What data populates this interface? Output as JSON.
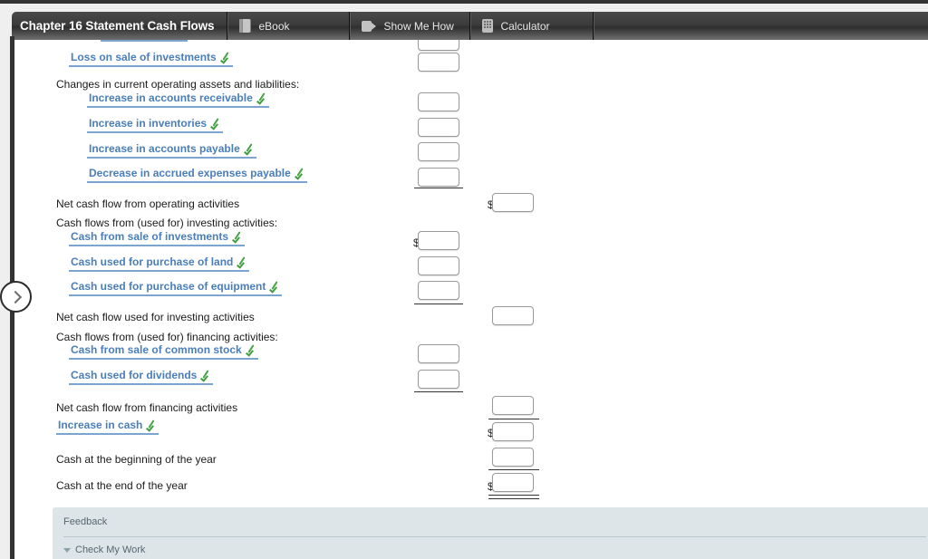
{
  "toolbar": {
    "title": "Chapter 16 Statement Cash Flows",
    "tabs": [
      {
        "label": "eBook",
        "icon": "book-icon"
      },
      {
        "label": "Show Me How",
        "icon": "video-camera-icon"
      },
      {
        "label": "Calculator",
        "icon": "calculator-icon"
      }
    ]
  },
  "expander": {
    "icon": "chevron-right-icon"
  },
  "statement": {
    "rows": [
      {
        "type": "pick",
        "label": "Loss on sale of investments",
        "indent": 63,
        "checked": true
      },
      {
        "type": "plain",
        "label": "Changes in current operating assets and liabilities:",
        "indent": 49
      },
      {
        "type": "pick",
        "label": "Increase in accounts receivable",
        "indent": 83,
        "checked": true
      },
      {
        "type": "pick",
        "label": "Increase in inventories",
        "indent": 83,
        "checked": true
      },
      {
        "type": "pick",
        "label": "Increase in accounts payable",
        "indent": 83,
        "checked": true
      },
      {
        "type": "pick",
        "label": "Decrease in accrued expenses payable",
        "indent": 83,
        "checked": true
      },
      {
        "type": "plain",
        "label": "Net cash flow from operating activities",
        "indent": 49
      },
      {
        "type": "plain",
        "label": "Cash flows from (used for) investing activities:",
        "indent": 49
      },
      {
        "type": "pick",
        "label": "Cash from sale of investments",
        "indent": 63,
        "checked": true
      },
      {
        "type": "pick",
        "label": "Cash used for purchase of land",
        "indent": 63,
        "checked": true
      },
      {
        "type": "pick",
        "label": "Cash used for purchase of equipment",
        "indent": 63,
        "checked": true
      },
      {
        "type": "plain",
        "label": "Net cash flow used for investing activities",
        "indent": 49
      },
      {
        "type": "plain",
        "label": "Cash flows from (used for) financing activities:",
        "indent": 49
      },
      {
        "type": "pick",
        "label": "Cash from sale of common stock",
        "indent": 63,
        "checked": true
      },
      {
        "type": "pick",
        "label": "Cash used for dividends",
        "indent": 63,
        "checked": true
      },
      {
        "type": "plain",
        "label": "Net cash flow from financing activities",
        "indent": 49
      },
      {
        "type": "pick",
        "label": "Increase in cash",
        "indent": 49,
        "checked": true
      },
      {
        "type": "plain",
        "label": "Cash at the beginning of the year",
        "indent": 49
      },
      {
        "type": "plain",
        "label": "Cash at the end of the year",
        "indent": 49
      }
    ],
    "inputs": [
      {
        "name": "input-loss-on-sale-of-investments",
        "value": "",
        "dollar": ""
      },
      {
        "name": "input-increase-accounts-receivable",
        "value": "",
        "dollar": ""
      },
      {
        "name": "input-increase-inventories",
        "value": "",
        "dollar": ""
      },
      {
        "name": "input-increase-accounts-payable",
        "value": "",
        "dollar": ""
      },
      {
        "name": "input-decrease-accrued-expenses-payable",
        "value": "",
        "dollar": ""
      },
      {
        "name": "input-net-cash-flow-operating",
        "value": "",
        "dollar": "$"
      },
      {
        "name": "input-cash-from-sale-of-investments",
        "value": "",
        "dollar": "$"
      },
      {
        "name": "input-cash-purchase-of-land",
        "value": "",
        "dollar": ""
      },
      {
        "name": "input-cash-purchase-of-equipment",
        "value": "",
        "dollar": ""
      },
      {
        "name": "input-net-cash-flow-investing",
        "value": "",
        "dollar": ""
      },
      {
        "name": "input-cash-from-sale-common-stock",
        "value": "",
        "dollar": ""
      },
      {
        "name": "input-cash-used-for-dividends",
        "value": "",
        "dollar": ""
      },
      {
        "name": "input-net-cash-flow-financing",
        "value": "",
        "dollar": ""
      },
      {
        "name": "input-increase-in-cash",
        "value": "",
        "dollar": "$"
      },
      {
        "name": "input-cash-beginning-of-year",
        "value": "",
        "dollar": ""
      },
      {
        "name": "input-cash-end-of-year",
        "value": "",
        "dollar": "$"
      }
    ]
  },
  "feedback": {
    "title": "Feedback",
    "check_my_work": "Check My Work",
    "toggle_icon": "triangle-down-icon"
  },
  "colors": {
    "link": "#4a7ebb",
    "check": "#4aa34a",
    "toolbar_dark": "#3c3c3c",
    "feedback_bg": "#dde5e8"
  }
}
